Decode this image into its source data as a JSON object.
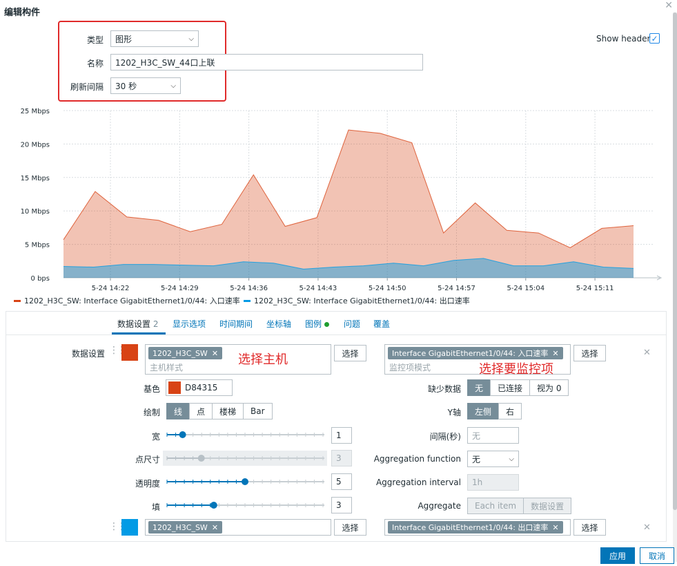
{
  "dialog": {
    "title": "编辑构件",
    "close_icon": "close-icon",
    "type_label": "类型",
    "type_value": "图形",
    "name_label": "名称",
    "name_value": "1202_H3C_SW_44口上联",
    "refresh_label": "刷新间隔",
    "refresh_value": "30 秒",
    "show_header_label": "Show header",
    "show_header_checked": true
  },
  "chart_data": {
    "type": "area",
    "x": [
      "5-24 14:15",
      "5-24 14:18",
      "5-24 14:22",
      "5-24 14:25",
      "5-24 14:29",
      "5-24 14:32",
      "5-24 14:36",
      "5-24 14:39",
      "5-24 14:43",
      "5-24 14:46",
      "5-24 14:50",
      "5-24 14:53",
      "5-24 14:57",
      "5-24 15:00",
      "5-24 15:04",
      "5-24 15:07",
      "5-24 15:11",
      "5-24 15:14"
    ],
    "x_tick_labels": [
      "5-24 14:22",
      "5-24 14:29",
      "5-24 14:36",
      "5-24 14:43",
      "5-24 14:50",
      "5-24 14:57",
      "5-24 15:04",
      "5-24 15:11"
    ],
    "y_tick_labels": [
      "0 bps",
      "5 Mbps",
      "10 Mbps",
      "15 Mbps",
      "20 Mbps",
      "25 Mbps"
    ],
    "ylim": [
      0,
      25
    ],
    "y_unit": "Mbps",
    "grid": true,
    "series": [
      {
        "name": "1202_H3C_SW: Interface GigabitEthernet1/0/44: 入口速率",
        "color": "#D84315",
        "values": [
          5.7,
          12.9,
          9.1,
          8.6,
          6.9,
          8.0,
          15.4,
          7.7,
          9.0,
          22.1,
          21.6,
          20.2,
          6.7,
          11.2,
          7.1,
          6.7,
          4.5,
          7.4,
          7.8
        ]
      },
      {
        "name": "1202_H3C_SW: Interface GigabitEthernet1/0/44: 出口速率",
        "color": "#039BE5",
        "values": [
          1.7,
          1.6,
          2.0,
          2.0,
          1.9,
          1.8,
          2.4,
          2.2,
          1.3,
          1.6,
          1.8,
          2.2,
          1.8,
          2.6,
          2.9,
          1.8,
          1.8,
          2.4,
          1.6,
          1.4
        ]
      }
    ]
  },
  "tabs": [
    {
      "label": "数据设置",
      "count": "2"
    },
    {
      "label": "显示选项"
    },
    {
      "label": "时间期间"
    },
    {
      "label": "坐标轴"
    },
    {
      "label": "图例"
    },
    {
      "label": "问题"
    },
    {
      "label": "覆盖"
    }
  ],
  "dataset1": {
    "label": "数据设置",
    "color_hex": "#D84315",
    "host_tag": "1202_H3C_SW",
    "host_placeholder": "主机样式",
    "select_label": "选择",
    "item_tag": "Interface GigabitEthernet1/0/44: 入口速率",
    "item_placeholder": "监控项模式",
    "annotation_host": "选择主机",
    "annotation_item": "选择要监控项",
    "base_color_label": "基色",
    "base_color_value": "D84315",
    "draw_label": "绘制",
    "draw_options": [
      "线",
      "点",
      "楼梯",
      "Bar"
    ],
    "width_label": "宽",
    "width_value": "1",
    "width_level": 0.1,
    "point_size_label": "点尺寸",
    "point_size_value": "3",
    "point_size_level": 0.22,
    "transparency_label": "透明度",
    "transparency_value": "5",
    "transparency_level": 0.5,
    "fill_label": "填",
    "fill_value": "3",
    "fill_level": 0.3,
    "missing_label": "缺少数据",
    "missing_options": [
      "无",
      "已连接",
      "视为 0"
    ],
    "yaxis_label": "Y轴",
    "yaxis_options": [
      "左侧",
      "右"
    ],
    "interval_label": "间隔(秒)",
    "interval_placeholder": "无",
    "agg_func_label": "Aggregation function",
    "agg_func_value": "无",
    "agg_interval_label": "Aggregation interval",
    "agg_interval_placeholder": "1h",
    "aggregate_label": "Aggregate",
    "aggregate_options": [
      "Each item",
      "数据设置"
    ]
  },
  "dataset2": {
    "color_hex": "#039BE5",
    "host_tag": "1202_H3C_SW",
    "select_label": "选择",
    "item_tag": "Interface GigabitEthernet1/0/44: 出口速率"
  },
  "footer": {
    "apply_label": "应用",
    "cancel_label": "取消"
  }
}
